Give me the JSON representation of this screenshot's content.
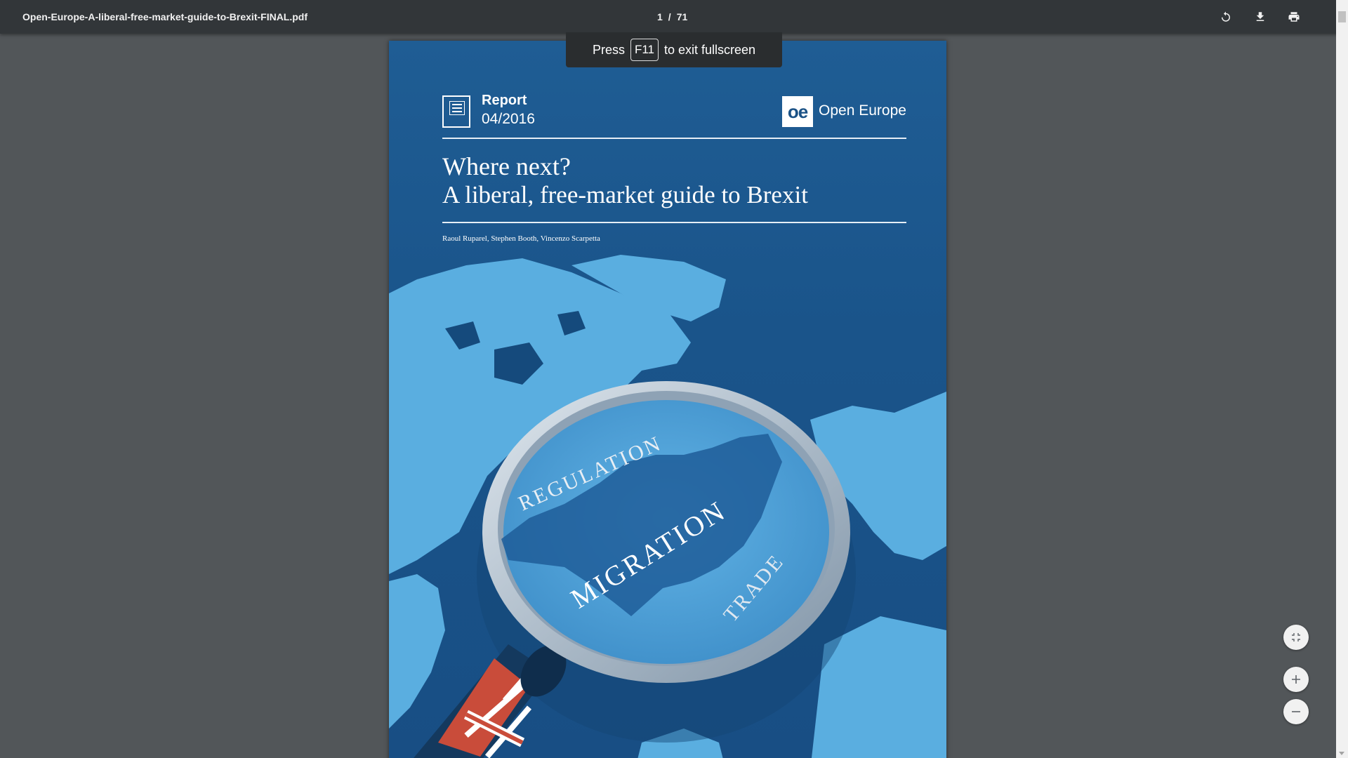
{
  "toolbar": {
    "filename": "Open-Europe-A-liberal-free-market-guide-to-Brexit-FINAL.pdf",
    "current_page": "1",
    "separator": "/",
    "total_pages": "71",
    "rotate_icon": "rotate-icon",
    "download_icon": "download-icon",
    "print_icon": "print-icon"
  },
  "toast": {
    "before": "Press",
    "key": "F11",
    "after": "to exit fullscreen"
  },
  "cover": {
    "report_label": "Report",
    "report_date": "04/2016",
    "logo_mark": "oe",
    "logo_name": "Open Europe",
    "title_line1": "Where next?",
    "title_line2": "A liberal, free-market guide to Brexit",
    "authors": "Raoul Ruparel, Stephen Booth, Vincenzo Scarpetta",
    "lens_words": {
      "top": "REGULATION",
      "center": "MIGRATION",
      "right": "TRADE"
    }
  },
  "controls": {
    "fit_icon": "fit-to-page-icon",
    "zoom_in_icon": "plus-icon",
    "zoom_out_icon": "minus-icon"
  },
  "colors": {
    "toolbar_bg": "#323639",
    "viewer_bg": "#525659",
    "cover_blue": "#1b5286",
    "map_light": "#5aaee0",
    "lens_rim": "#aebccb"
  }
}
